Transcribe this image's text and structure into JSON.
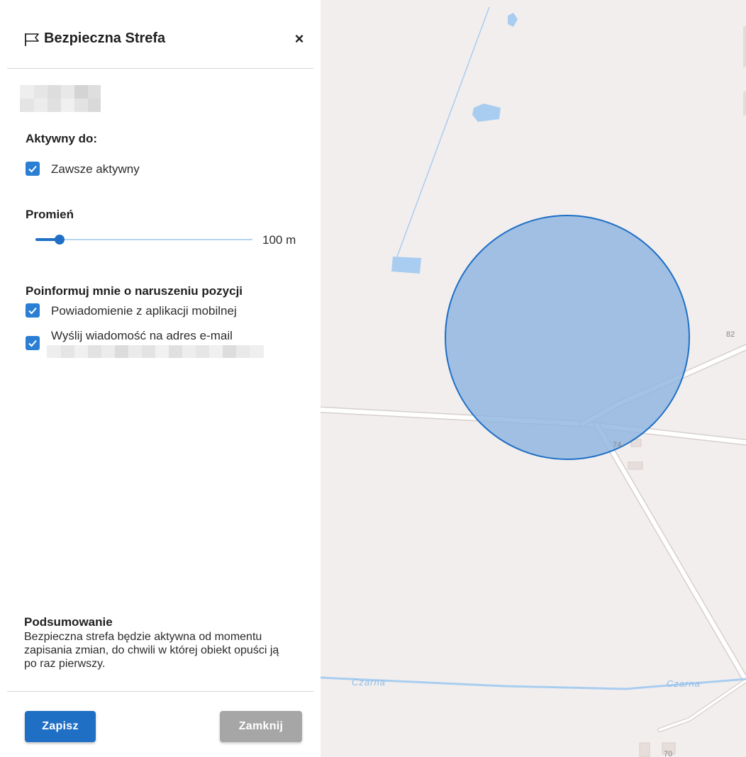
{
  "panel": {
    "title": "Bezpieczna Strefa",
    "close_symbol": "×",
    "active_until": {
      "heading": "Aktywny do:",
      "always_active_label": "Zawsze aktywny",
      "always_active_checked": true
    },
    "radius": {
      "heading": "Promień",
      "value_label": "100 m",
      "slider_fraction": 0.11
    },
    "notify": {
      "heading": "Poinformuj mnie o naruszeniu pozycji",
      "mobile_label": "Powiadomienie z aplikacji mobilnej",
      "mobile_checked": true,
      "email_label": "Wyślij wiadomość na adres e-mail",
      "email_checked": true
    },
    "summary": {
      "heading": "Podsumowanie",
      "text": "Bezpieczna strefa będzie aktywna od momentu zapisania zmian, do chwili w której obiekt opuści ją po raz pierwszy."
    },
    "buttons": {
      "save_label": "Zapisz",
      "close_label": "Zamknij"
    }
  },
  "map": {
    "river_label": "Czarna",
    "address_labels": [
      "82",
      "74",
      "70"
    ],
    "zone_fill_color": "#8db4e0",
    "zone_stroke_color": "#1f6fc5"
  },
  "icons": {
    "title_icon": "flag-icon",
    "close_icon": "close-icon",
    "checkbox_icon": "checkmark-icon"
  },
  "colors": {
    "accent": "#1f6fc5",
    "checkbox": "#2a7fd4",
    "disabled_button": "#a6a6a6",
    "map_background": "#f2eeee"
  }
}
